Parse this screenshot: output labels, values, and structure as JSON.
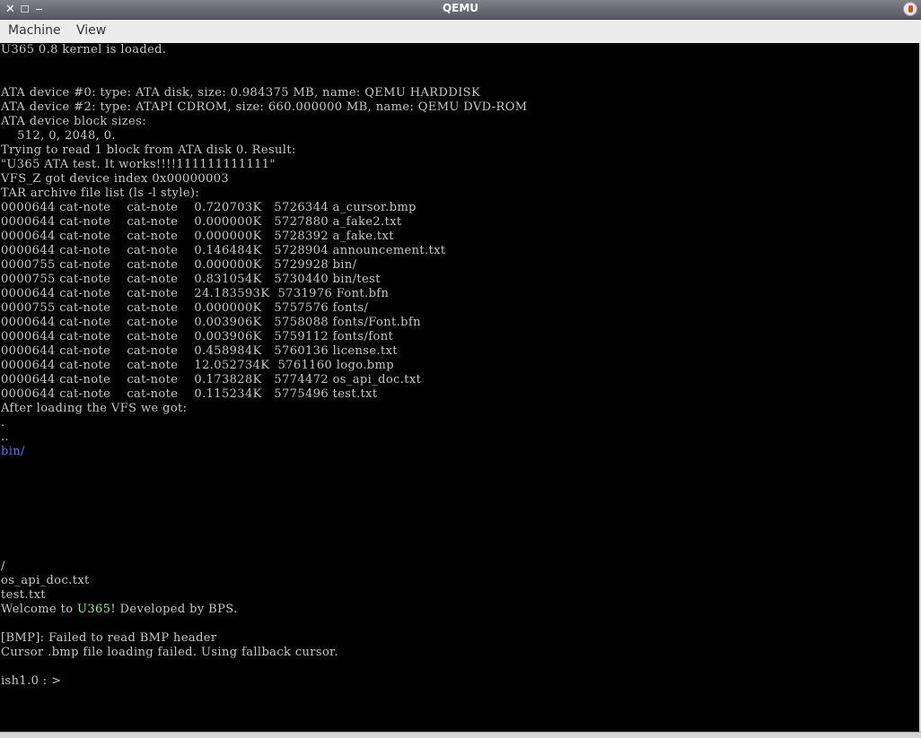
{
  "window": {
    "title": "QEMU"
  },
  "menu": {
    "machine": "Machine",
    "view": "View"
  },
  "console": {
    "l1": "U365 0.8 kernel is loaded.",
    "l4": "ATA device #0: type: ATA disk, size: 0.984375 MB, name: QEMU HARDDISK",
    "l5": "ATA device #2: type: ATAPI CDROM, size: 660.000000 MB, name: QEMU DVD-ROM",
    "l6": "ATA device block sizes:",
    "l7": "    512, 0, 2048, 0.",
    "l8": "Trying to read 1 block from ATA disk 0. Result:",
    "l9": "\"U365 ATA test. It works!!!!111111111111\"",
    "l10": "VFS_Z got device index 0x00000003",
    "l11": "TAR archive file list (ls -l style):",
    "tar": [
      "0000644 cat-note    cat-note    0.720703K   5726344 a_cursor.bmp",
      "0000644 cat-note    cat-note    0.000000K   5727880 a_fake2.txt",
      "0000644 cat-note    cat-note    0.000000K   5728392 a_fake.txt",
      "0000644 cat-note    cat-note    0.146484K   5728904 announcement.txt",
      "0000755 cat-note    cat-note    0.000000K   5729928 bin/",
      "0000755 cat-note    cat-note    0.831054K   5730440 bin/test",
      "0000644 cat-note    cat-note    24.183593K  5731976 Font.bfn",
      "0000755 cat-note    cat-note    0.000000K   5757576 fonts/",
      "0000644 cat-note    cat-note    0.003906K   5758088 fonts/Font.bfn",
      "0000644 cat-note    cat-note    0.003906K   5759112 fonts/font",
      "0000644 cat-note    cat-note    0.458984K   5760136 license.txt",
      "0000644 cat-note    cat-note    12.052734K  5761160 logo.bmp",
      "0000644 cat-note    cat-note    0.173828K   5774472 os_api_doc.txt",
      "0000644 cat-note    cat-note    0.115234K   5775496 test.txt"
    ],
    "after_vfs": "After loading the VFS we got:",
    "dot": ".",
    "dotdot": "..",
    "bin": "bin/",
    "slash": "/",
    "os_api": "os_api_doc.txt",
    "test": "test.txt",
    "welcome_pre": "Welcome to ",
    "welcome_name": "U365",
    "welcome_post": "! Developed by BPS.",
    "bmp_err": "[BMP]: Failed to read BMP header",
    "cursor_err": "Cursor .bmp file loading failed. Using fallback cursor.",
    "prompt": "ish1.0 : >"
  },
  "colors": {
    "text": "#c8c8c8",
    "dir": "#6a6aff",
    "brand": "#7dff7d",
    "background": "#000000"
  }
}
